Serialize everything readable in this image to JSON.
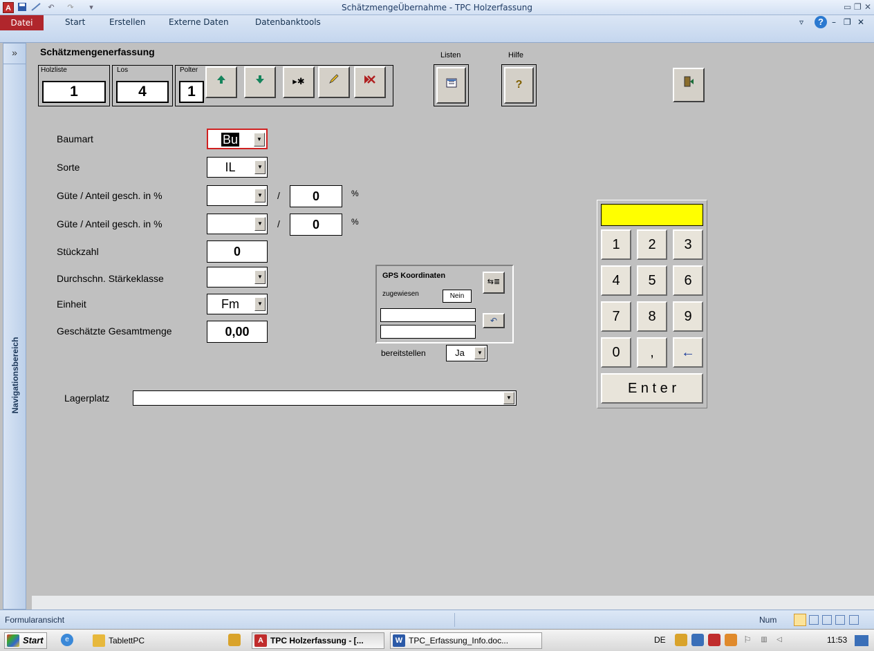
{
  "window": {
    "title": "SchätzmengeÜbernahme - TPC Holzerfassung"
  },
  "ribbon": {
    "tabs": [
      "Datei",
      "Start",
      "Erstellen",
      "Externe Daten",
      "Datenbanktools"
    ]
  },
  "navpane": {
    "toggle": "»",
    "label": "Navigationsbereich"
  },
  "form": {
    "title": "Schätzmengenerfassung",
    "holzliste": {
      "label": "Holzliste",
      "value": "1"
    },
    "los": {
      "label": "Los",
      "value": "4"
    },
    "polter": {
      "label": "Polter",
      "value": "1"
    },
    "listen_label": "Listen",
    "hilfe_label": "Hilfe",
    "fields": {
      "baumart": {
        "label": "Baumart",
        "value": "Bu"
      },
      "sorte": {
        "label": "Sorte",
        "value": "IL"
      },
      "guete1": {
        "label": "Güte / Anteil gesch. in %",
        "value": "",
        "anteil": "0",
        "sep": "/",
        "unit": "%"
      },
      "guete2": {
        "label": "Güte / Anteil gesch. in %",
        "value": "",
        "anteil": "0",
        "sep": "/",
        "unit": "%"
      },
      "stueckzahl": {
        "label": "Stückzahl",
        "value": "0"
      },
      "staerkeklasse": {
        "label": "Durchschn. Stärkeklasse",
        "value": ""
      },
      "einheit": {
        "label": "Einheit",
        "value": "Fm"
      },
      "gesamtmenge": {
        "label": "Geschätzte Gesamtmenge",
        "value": "0,00"
      },
      "lagerplatz": {
        "label": "Lagerplatz",
        "value": ""
      }
    },
    "gps": {
      "title": "GPS Koordinaten",
      "zugewiesen_label": "zugewiesen",
      "zugewiesen_value": "Nein",
      "coord1": "",
      "coord2": ""
    },
    "bereitstellen": {
      "label": "bereitstellen",
      "value": "Ja"
    },
    "keypad": {
      "display": "",
      "display_color": "#ffff00",
      "keys": [
        "1",
        "2",
        "3",
        "4",
        "5",
        "6",
        "7",
        "8",
        "9",
        "0",
        ",",
        "←"
      ],
      "enter": "E n t e r"
    }
  },
  "status": {
    "left": "Formularansicht",
    "right": "Num"
  },
  "taskbar": {
    "start": "Start",
    "items": [
      "TablettPC",
      "TPC Holzerfassung - [...",
      "TPC_Erfassung_Info.doc..."
    ],
    "lang": "DE",
    "time": "11:53"
  }
}
